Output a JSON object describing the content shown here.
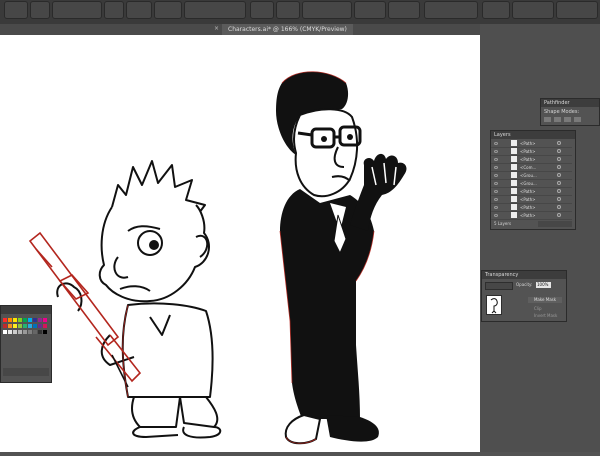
{
  "document": {
    "tab_title": "Characters.ai* @ 166% (CMYK/Preview)",
    "tab_close": "×"
  },
  "panels": {
    "pathfinder": {
      "title": "Pathfinder",
      "shape_modes_label": "Shape Modes:",
      "pathfinders_label": "Pathfinders:"
    },
    "layers": {
      "title": "Layers",
      "rows": [
        {
          "label": "<Path>"
        },
        {
          "label": "<Path>"
        },
        {
          "label": "<Path>"
        },
        {
          "label": "<Com..."
        },
        {
          "label": "<Grou..."
        },
        {
          "label": "<Grou..."
        },
        {
          "label": "<Path>"
        },
        {
          "label": "<Path>"
        },
        {
          "label": "<Path>"
        },
        {
          "label": "<Path>"
        }
      ],
      "footer": "5 Layers"
    },
    "transparency": {
      "title": "Transparency",
      "opacity_label": "Opacity:",
      "opacity_value": "100%",
      "make_mask": "Make Mask",
      "clip": "Clip",
      "invert_mask": "Invert Mask"
    }
  },
  "colors": {
    "app_bg": "#535353",
    "canvas": "#ffffff",
    "art_red": "#b3261e",
    "art_black": "#111111"
  }
}
